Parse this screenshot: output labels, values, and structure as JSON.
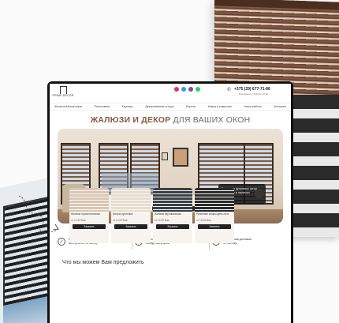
{
  "brand": {
    "logo_text": "PRIME DECOR"
  },
  "header": {
    "phone": "+375 (29) 677-71-86",
    "hours": "Ежедневно с 9:00 до 20:00",
    "socials": [
      {
        "icon": "instagram-icon",
        "color": "#e1306c"
      },
      {
        "icon": "telegram-icon",
        "color": "#2aa3df"
      },
      {
        "icon": "viber-icon",
        "color": "#7b519d"
      },
      {
        "icon": "whatsapp-icon",
        "color": "#25d366"
      }
    ]
  },
  "nav": {
    "items": [
      "Жалюзи Минск/заказ",
      "Рольставни",
      "Карнизы",
      "Декоративные шторы",
      "Ворота",
      "Ковры и ковролин",
      "Наши работы",
      "Контакты"
    ]
  },
  "hero": {
    "headline_accent": "ЖАЛЮЗИ И ДЕКОР",
    "headline_rest": "ДЛЯ ВАШИХ ОКОН",
    "card_line1": "Все виды рулонных штор",
    "card_line2": "и жалюзи в наличии"
  },
  "features": [
    {
      "icon": "check-icon",
      "text_line1": "Более 5000",
      "text_line2": "материалов на выбор"
    },
    {
      "icon": "check-icon",
      "text_line1": "Бесплатный",
      "text_line2": "выезд замерщика"
    },
    {
      "icon": "check-icon",
      "text_line1": "Бесплатная доставка",
      "text_line2": "по Минску"
    }
  ],
  "offers": {
    "title": "Что мы можем Вам предложить",
    "products": [
      {
        "name": "Жалюзи горизонтальные",
        "price": "от 12 BYN/м²",
        "button": "Заказать",
        "color": "#d9c7b4"
      },
      {
        "name": "Шторы рулонные",
        "price": "от 14 BYN/м²",
        "button": "Заказать",
        "color": "#e6dccf"
      },
      {
        "name": "Жалюзи вертикальные",
        "price": "от 10 BYN/м²",
        "button": "Заказать",
        "color": "#3a3f46"
      },
      {
        "name": "Рулонные шторы день-ночь",
        "price": "от 18 BYN/м²",
        "button": "Заказать",
        "color": "#2a2a2a"
      }
    ]
  }
}
